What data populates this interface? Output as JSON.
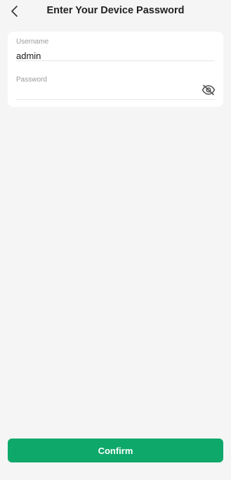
{
  "header": {
    "title": "Enter Your Device Password",
    "back_icon": "chevron-left-icon"
  },
  "form": {
    "username": {
      "label": "Username",
      "value": "admin"
    },
    "password": {
      "label": "Password",
      "value": "",
      "visibility_icon": "eye-off-icon"
    }
  },
  "actions": {
    "confirm_label": "Confirm"
  },
  "colors": {
    "background": "#f5f5f5",
    "card": "#ffffff",
    "accent": "#0ea86b",
    "label": "#9a9a9a",
    "text": "#1a1a1a"
  }
}
